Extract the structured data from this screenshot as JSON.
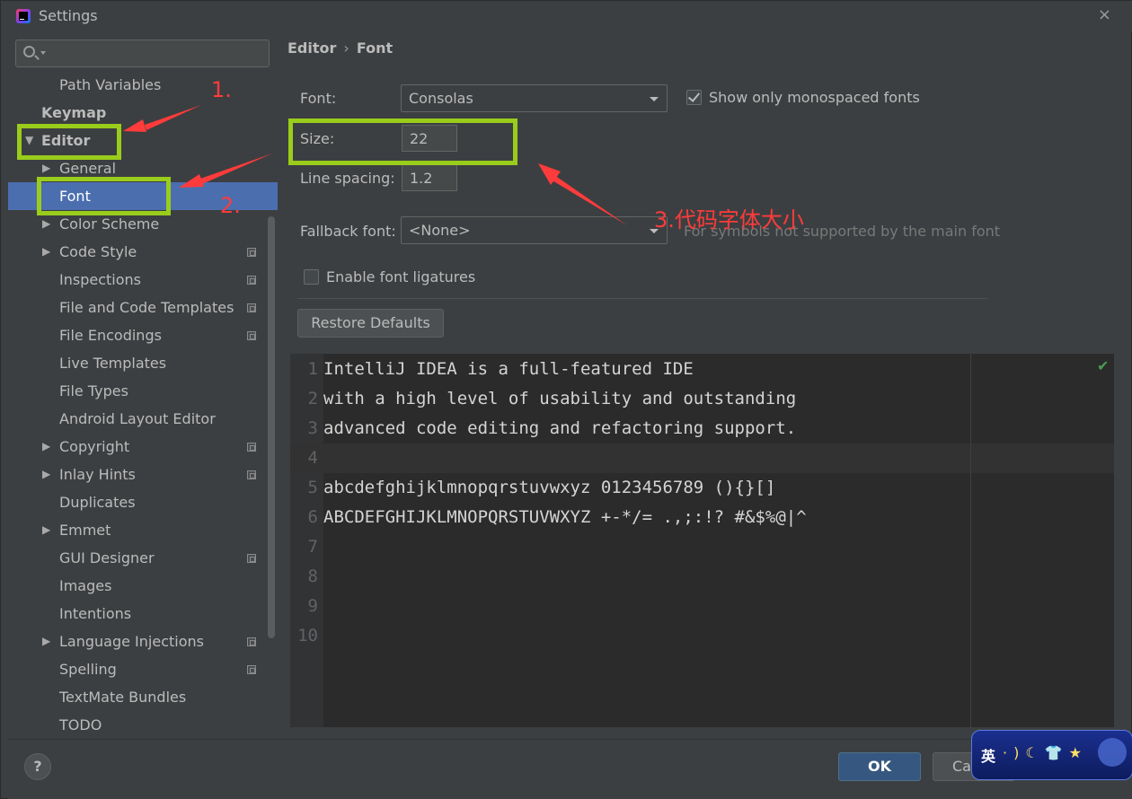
{
  "window": {
    "title": "Settings",
    "close_glyph": "×"
  },
  "sidebar": {
    "search": {
      "placeholder": ""
    },
    "items": [
      {
        "label": "Path Variables",
        "level": 1,
        "arrow": "",
        "icon": false
      },
      {
        "label": "Keymap",
        "level": 0,
        "arrow": "",
        "icon": false,
        "bold": true
      },
      {
        "label": "Editor",
        "level": 0,
        "arrow": "▼",
        "icon": false,
        "bold": true
      },
      {
        "label": "General",
        "level": 1,
        "arrow": "▶",
        "icon": false
      },
      {
        "label": "Font",
        "level": 1,
        "arrow": "",
        "icon": false,
        "selected": true
      },
      {
        "label": "Color Scheme",
        "level": 1,
        "arrow": "▶",
        "icon": false
      },
      {
        "label": "Code Style",
        "level": 1,
        "arrow": "▶",
        "icon": true
      },
      {
        "label": "Inspections",
        "level": 1,
        "arrow": "",
        "icon": true
      },
      {
        "label": "File and Code Templates",
        "level": 1,
        "arrow": "",
        "icon": true
      },
      {
        "label": "File Encodings",
        "level": 1,
        "arrow": "",
        "icon": true
      },
      {
        "label": "Live Templates",
        "level": 1,
        "arrow": "",
        "icon": false
      },
      {
        "label": "File Types",
        "level": 1,
        "arrow": "",
        "icon": false
      },
      {
        "label": "Android Layout Editor",
        "level": 1,
        "arrow": "",
        "icon": false
      },
      {
        "label": "Copyright",
        "level": 1,
        "arrow": "▶",
        "icon": true
      },
      {
        "label": "Inlay Hints",
        "level": 1,
        "arrow": "▶",
        "icon": true
      },
      {
        "label": "Duplicates",
        "level": 1,
        "arrow": "",
        "icon": false
      },
      {
        "label": "Emmet",
        "level": 1,
        "arrow": "▶",
        "icon": false
      },
      {
        "label": "GUI Designer",
        "level": 1,
        "arrow": "",
        "icon": true
      },
      {
        "label": "Images",
        "level": 1,
        "arrow": "",
        "icon": false
      },
      {
        "label": "Intentions",
        "level": 1,
        "arrow": "",
        "icon": false
      },
      {
        "label": "Language Injections",
        "level": 1,
        "arrow": "▶",
        "icon": true
      },
      {
        "label": "Spelling",
        "level": 1,
        "arrow": "",
        "icon": true
      },
      {
        "label": "TextMate Bundles",
        "level": 1,
        "arrow": "",
        "icon": false
      },
      {
        "label": "TODO",
        "level": 1,
        "arrow": "",
        "icon": false
      }
    ]
  },
  "breadcrumb": {
    "parent": "Editor",
    "separator": "›",
    "current": "Font"
  },
  "font_settings": {
    "font_label": "Font:",
    "font_value": "Consolas",
    "monospaced_checkbox_label": "Show only monospaced fonts",
    "monospaced_checked": true,
    "size_label": "Size:",
    "size_value": "22",
    "line_spacing_label": "Line spacing:",
    "line_spacing_value": "1.2",
    "fallback_label": "Fallback font:",
    "fallback_value": "<None>",
    "fallback_hint": "For symbols not supported by the main font",
    "ligatures_label": "Enable font ligatures",
    "ligatures_checked": false,
    "restore_button": "Restore Defaults"
  },
  "preview": {
    "lines": [
      {
        "n": "1",
        "text": "IntelliJ IDEA is a full-featured IDE"
      },
      {
        "n": "2",
        "text": "with a high level of usability and outstanding"
      },
      {
        "n": "3",
        "text": "advanced code editing and refactoring support."
      },
      {
        "n": "4",
        "text": ""
      },
      {
        "n": "5",
        "text": "abcdefghijklmnopqrstuvwxyz 0123456789 (){}[]"
      },
      {
        "n": "6",
        "text": "ABCDEFGHIJKLMNOPQRSTUVWXYZ +-*/= .,;:!? #&$%@|^"
      },
      {
        "n": "7",
        "text": ""
      },
      {
        "n": "8",
        "text": ""
      },
      {
        "n": "9",
        "text": ""
      },
      {
        "n": "10",
        "text": ""
      }
    ],
    "status_icon": "check-icon"
  },
  "annotations": {
    "step1": "1.",
    "step2": "2.",
    "step3": "3.代码字体大小",
    "color_box": "#9acd1b",
    "color_arrow": "#ff3b3b"
  },
  "footer": {
    "help": "?",
    "ok_button": "OK",
    "cancel_button": "Ca"
  },
  "ime": {
    "char": "英",
    "icons": "·)☾👕★"
  },
  "colors": {
    "selected_bg": "#4b6eaf",
    "panel_bg": "#3c3f41",
    "editor_bg": "#2b2b2b"
  }
}
